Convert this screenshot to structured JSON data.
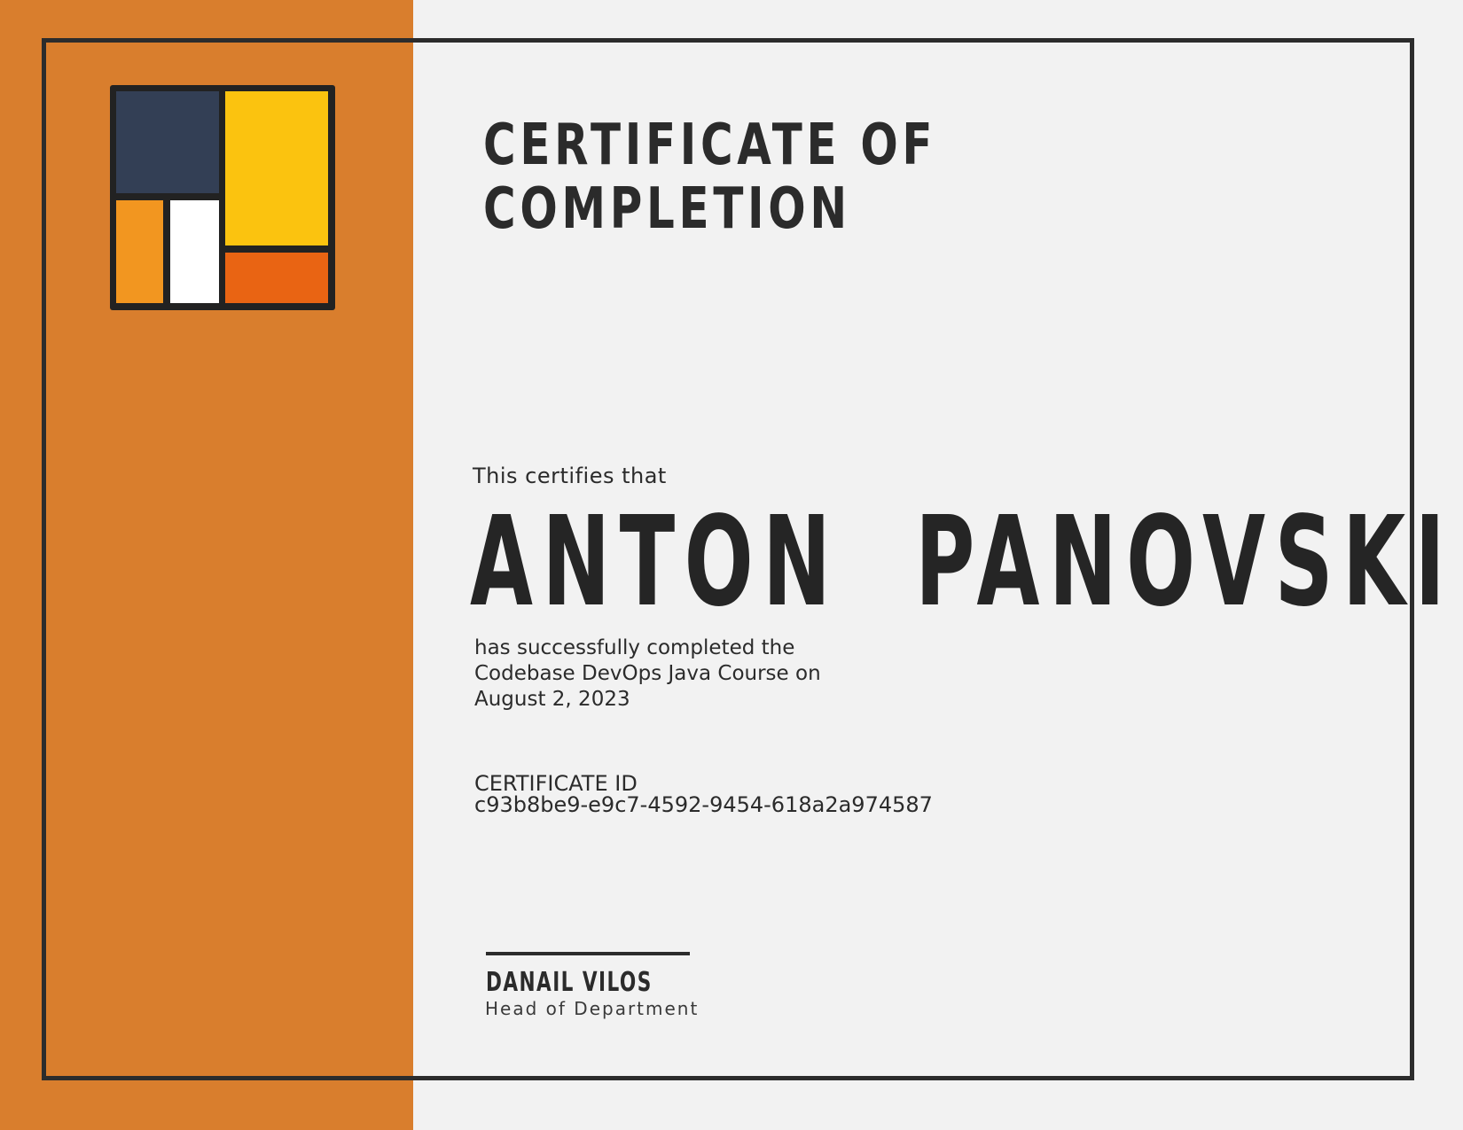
{
  "certificate": {
    "title_line1": "CERTIFICATE OF",
    "title_line2": "COMPLETION",
    "certifies_text": "This certifies that",
    "recipient_name": "ANTON  PANOVSKI",
    "completion_line1": "has successfully completed the",
    "completion_line2": "Codebase DevOps Java Course on",
    "completion_line3": "August 2, 2023",
    "id_label": "CERTIFICATE ID",
    "id_value": "c93b8be9-e9c7-4592-9454-618a2a974587"
  },
  "signature": {
    "name": "DANAIL VILOS",
    "role": "Head of Department"
  },
  "logo": {
    "icon": "color-block-logo-icon",
    "colors": {
      "navy": "#333f55",
      "yellow": "#fbc30f",
      "orange": "#f29620",
      "white": "#ffffff",
      "red_orange": "#e96413"
    }
  },
  "colors": {
    "side_band": "#d97e2d",
    "background": "#f2f2f2",
    "frame": "#2c2c2c",
    "text": "#2b2b2b"
  }
}
